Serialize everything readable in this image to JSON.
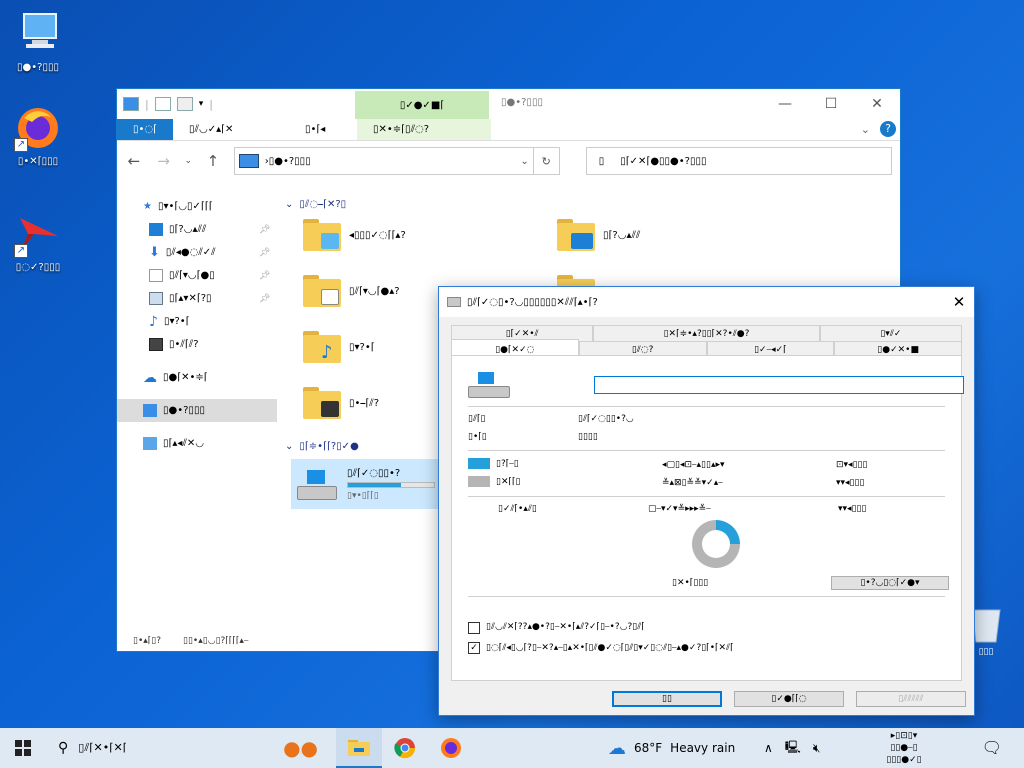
{
  "desktop": {
    "icons": [
      {
        "label": "▯●•?▯▯▯"
      },
      {
        "label": "▯•✕⌈▯▯▯"
      },
      {
        "label": "▯◌✓?▯▯▯"
      }
    ],
    "recycle_label": "▯▯▯"
  },
  "explorer": {
    "context_tab_label": "▯✓●✓■⌈",
    "title": "▯●•?▯▯▯",
    "ribbon_tabs": [
      "▯•◌⌈",
      "▯⫽◡✓▴⌈✕",
      "▯•⌈◂",
      "▯✕•≑⌈▯⫽◌?"
    ],
    "address_text": "›▯●•?▯▯▯",
    "search_placeholder": "▯⌈✓✕⌈●▯▯●•?▯▯▯",
    "quick_access_label": "▯▾•⌈◡▯✓⌈⌈⌈",
    "nav_items": [
      {
        "label": "▯⌈?◡▴⫽⫽",
        "pinned": true
      },
      {
        "label": "▯⫽◂●◌⫽✓⫽",
        "pinned": true
      },
      {
        "label": "▯⫽⌈▾◡⌈●▯",
        "pinned": true
      },
      {
        "label": "▯⌈▴▾✕⌈?▯",
        "pinned": true
      },
      {
        "label": "▯▾?•⌈",
        "pinned": false
      },
      {
        "label": "▯•⫽⌈⫽?",
        "pinned": false
      }
    ],
    "onedrive_label": "▯●⌈✕•≑⌈",
    "this_pc_label": "▯●•?▯▯▯",
    "network_label": "▯⌈▴◂⫽✕◡",
    "group_folders_label": "▯⫽◌⎯⌈✕?▯",
    "group_devices_label": "▯⌈≑•⌈⌈?▯✓●",
    "folders": [
      "◂▯▯▯✓◌⌈⌈▴?",
      "▯⌈?◡▴⫽⫽",
      "▯⫽⌈▾◡⌈●▴?",
      "▯⫽◂●◌⫽✓⫽",
      "▯▾?•⌈",
      "▯•⎯⌈⫽?"
    ],
    "drive": {
      "label": "▯⫽⌈✓◌▯▯•?",
      "free_text": "▯▾•▯⌈⌈▯",
      "used_fraction": 0.62
    },
    "status_items": "▯•▴⌈▯?",
    "status_selected": "▯▯•▴▯◡▯?⌈⌈⌈⌈▴⎯"
  },
  "dialog": {
    "title": "▯⫽⌈✓◌▯•?◡▯▯▯▯▯▯✕⫽⫽⌈▴•⌈?",
    "tabs_row1": [
      "▯⌈✓✕•⫽",
      "▯✕⌈≑•▴?▯▯⌈✕?•⫽●?",
      "▯▾⫽✓"
    ],
    "tabs_row2": [
      "▯●⌈✕✓◌",
      "▯⫽◌?",
      "▯✓⎯◂✓⌈",
      "▯●✓✕•■"
    ],
    "type_label": "▯⫽⌈▯",
    "type_value": "▯⫽⌈✓◌▯▯•?◡",
    "fs_label": "▯•⌈▯",
    "fs_value": "▯▯▯▯",
    "used_label": "▯?⌈⎯▯",
    "used_bytes": "◂▢▯◂⊡⎯▴▯▯▴▸▾",
    "used_short": "⊡▾◂▯▯▯",
    "free_label": "▯✕⌈⌈▯",
    "free_bytes": "≚▴⊠▯≚≚▾✓▴⎯",
    "free_short": "▾▾◂▯▯▯",
    "capacity_label": "▯✓⫽⌈•▴⫽▯",
    "capacity_bytes": "▢⎯▾✓▾≚▸▸▸≚⎯",
    "capacity_short": "▾▾◂▯▯▯",
    "used_fraction": 0.25,
    "drive_label": "▯✕•⌈▯▯▯",
    "cleanup_button": "▯•?◡▯◌⌈✓●▾",
    "compress_label": "▯⫽◡⫽✕⌈??▴●•?▯⎯✕•⌈▴⫽?✓⌈▯⎯•?◡?▯⫽⌈",
    "index_label": "▯◌⌈⫽◂▯◡⌈?▯⎯✕?▴⎯▯▴✕•⌈▯⫽●✓◌⌈▯⫽▯▾✓▯◌⫽▯⎯▴●✓?▯⌈•⌈✕⫽⌈",
    "compress_checked": false,
    "index_checked": true,
    "ok_button": "▯▯",
    "cancel_button": "▯✓●⌈⌈◌",
    "apply_button": "▯⫽⫽⫽⫽⫽"
  },
  "taskbar": {
    "search_text": "▯⫽⌈✕•⌈✕⌈",
    "weather_temp": "68°F",
    "weather_desc": "Heavy rain",
    "clock_line1": "▸▯⊡▯▾",
    "clock_line2": "▯▯●⎯▯",
    "clock_line3": "▯▯▯●✓▯"
  },
  "colors": {
    "accent": "#1979ca",
    "used_space": "#26a0da",
    "free_space": "#b5b5b5"
  }
}
